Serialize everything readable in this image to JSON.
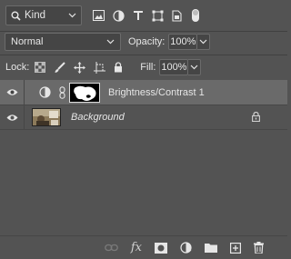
{
  "filter": {
    "kind_label": "Kind",
    "icons": [
      "image-filter-icon",
      "adjustment-filter-icon",
      "type-filter-icon",
      "shape-filter-icon",
      "smart-object-filter-icon",
      "filter-toggle"
    ]
  },
  "blend": {
    "mode": "Normal",
    "opacity_label": "Opacity:",
    "opacity_value": "100%"
  },
  "lock": {
    "label": "Lock:",
    "fill_label": "Fill:",
    "fill_value": "100%"
  },
  "layers": [
    {
      "name": "Brightness/Contrast 1",
      "type": "adjustment",
      "visible": true,
      "selected": true
    },
    {
      "name": "Background",
      "type": "background",
      "visible": true,
      "locked": true
    }
  ],
  "bottom_bar": {
    "fx_label": "fx",
    "icons": [
      "link-layers-icon",
      "fx-icon",
      "add-mask-icon",
      "new-adjustment-icon",
      "new-group-icon",
      "new-layer-icon",
      "delete-layer-icon"
    ]
  },
  "colors": {
    "panel": "#535353",
    "selected_row": "#6a6a6a",
    "field": "#454545",
    "text": "#e6e6e6"
  }
}
